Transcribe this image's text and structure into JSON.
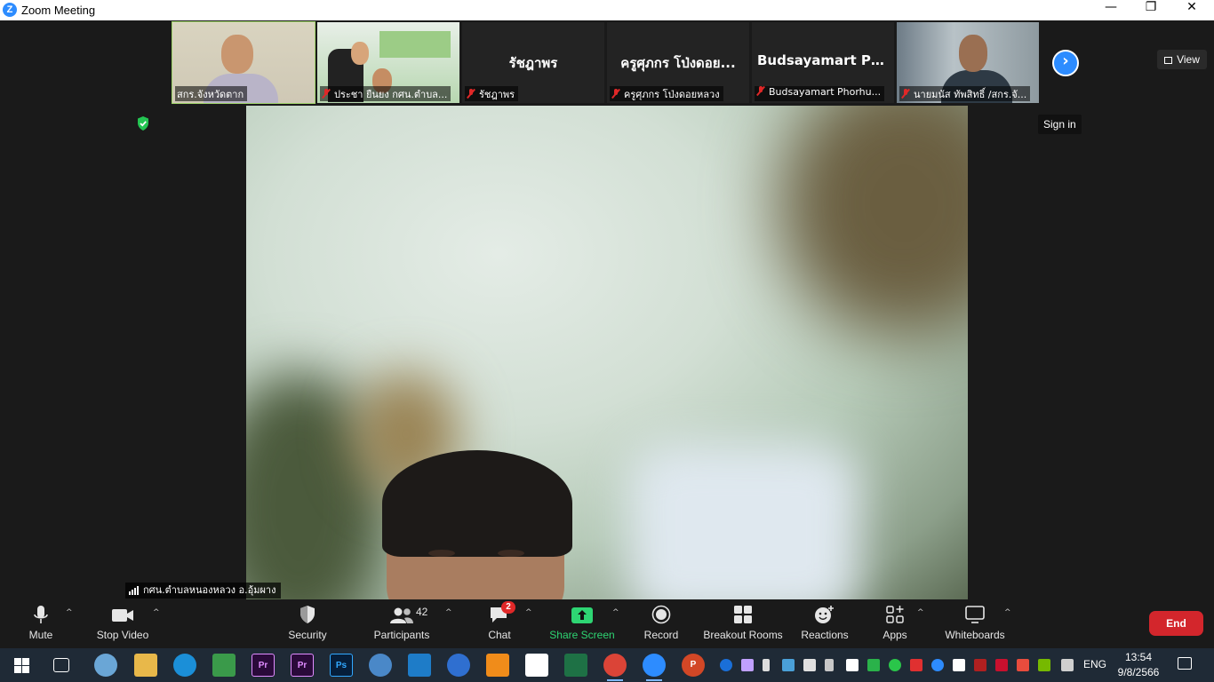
{
  "window": {
    "title": "Zoom Meeting",
    "logo_letter": "Z",
    "controls": {
      "minimize": "—",
      "restore": "❐",
      "close": "✕"
    }
  },
  "thumbnails": [
    {
      "label": "สกร.จังหวัดตาก",
      "muted": false,
      "video": true
    },
    {
      "label": "ประชา  ยืนยง กศน.ตำบล...",
      "muted": true,
      "video": true
    },
    {
      "display_name": "รัชฎาพร",
      "label": "รัชฎาพร",
      "muted": true,
      "video": false
    },
    {
      "display_name": "ครูศุภกร โป่งดอย...",
      "label": "ครูศุภกร โป่งดอยหลวง",
      "muted": true,
      "video": false
    },
    {
      "display_name": "Budsayamart  Ph...",
      "label": "Budsayamart Phorhu...",
      "muted": true,
      "video": false
    },
    {
      "label": "นายมนัส ทัพสิทธิ์ /สกร.จั...",
      "muted": true,
      "video": true
    }
  ],
  "next_icon": "chevron-right-icon",
  "view_button": {
    "label": "View"
  },
  "sign_in": "Sign in",
  "speaker_label": "กศน.ตำบลหนองหลวง อ.อุ้มผาง",
  "toolbar": {
    "mute": "Mute",
    "stop_video": "Stop Video",
    "security": "Security",
    "participants": "Participants",
    "participants_count": "42",
    "chat": "Chat",
    "chat_badge": "2",
    "share_screen": "Share Screen",
    "record": "Record",
    "breakout_rooms": "Breakout Rooms",
    "reactions": "Reactions",
    "apps": "Apps",
    "whiteboards": "Whiteboards",
    "end": "End",
    "caret": "^"
  },
  "taskbar": {
    "language": "ENG",
    "time": "13:54",
    "date": "9/8/2566",
    "apps": [
      "Pr",
      "Pr",
      "Ps",
      "P"
    ]
  },
  "colors": {
    "accent": "#2d8cff",
    "share_green": "#2ed573",
    "end_red": "#d3262c",
    "active_speaker": "#9fd36a"
  }
}
